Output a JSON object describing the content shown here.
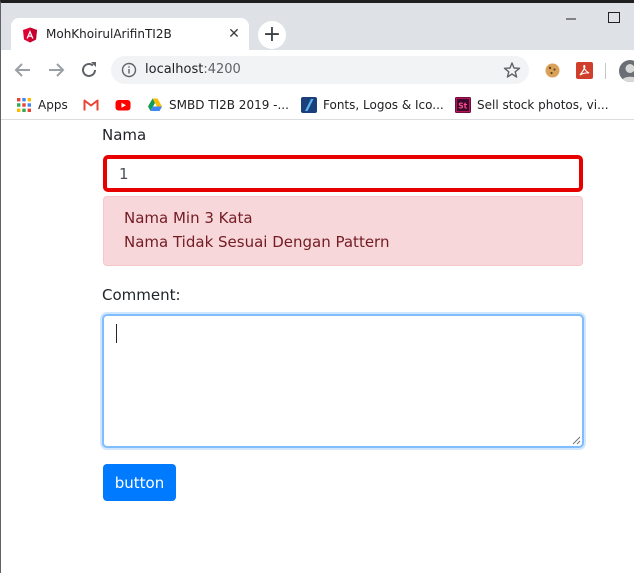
{
  "browser": {
    "tab": {
      "title": "MohKhoirulArifinTI2B",
      "favicon": "angular-icon",
      "close": "✕"
    },
    "new_tab_symbol": "+",
    "address": {
      "host": "localhost",
      "port": ":4200"
    },
    "bookmarks": [
      {
        "label": "Apps",
        "icon": "apps-grid-icon"
      },
      {
        "label": "",
        "icon": "gmail-icon"
      },
      {
        "label": "",
        "icon": "youtube-icon"
      },
      {
        "label": "SMBD TI2B 2019 -...",
        "icon": "google-drive-icon"
      },
      {
        "label": "Fonts, Logos & Ico...",
        "icon": "fonts-site-icon"
      },
      {
        "label": "Sell stock photos, vi...",
        "icon": "adobe-stock-icon"
      }
    ]
  },
  "form": {
    "nama_label": "Nama",
    "nama_value": "1",
    "errors": [
      "Nama Min 3 Kata",
      "Nama Tidak Sesuai Dengan Pattern"
    ],
    "comment_label": "Comment:",
    "comment_value": "",
    "button_label": "button"
  },
  "colors": {
    "invalid_border": "#e60000",
    "alert_bg": "#f8d7da",
    "alert_text": "#721c24",
    "primary": "#007bff",
    "focus_border": "#80bdff"
  }
}
